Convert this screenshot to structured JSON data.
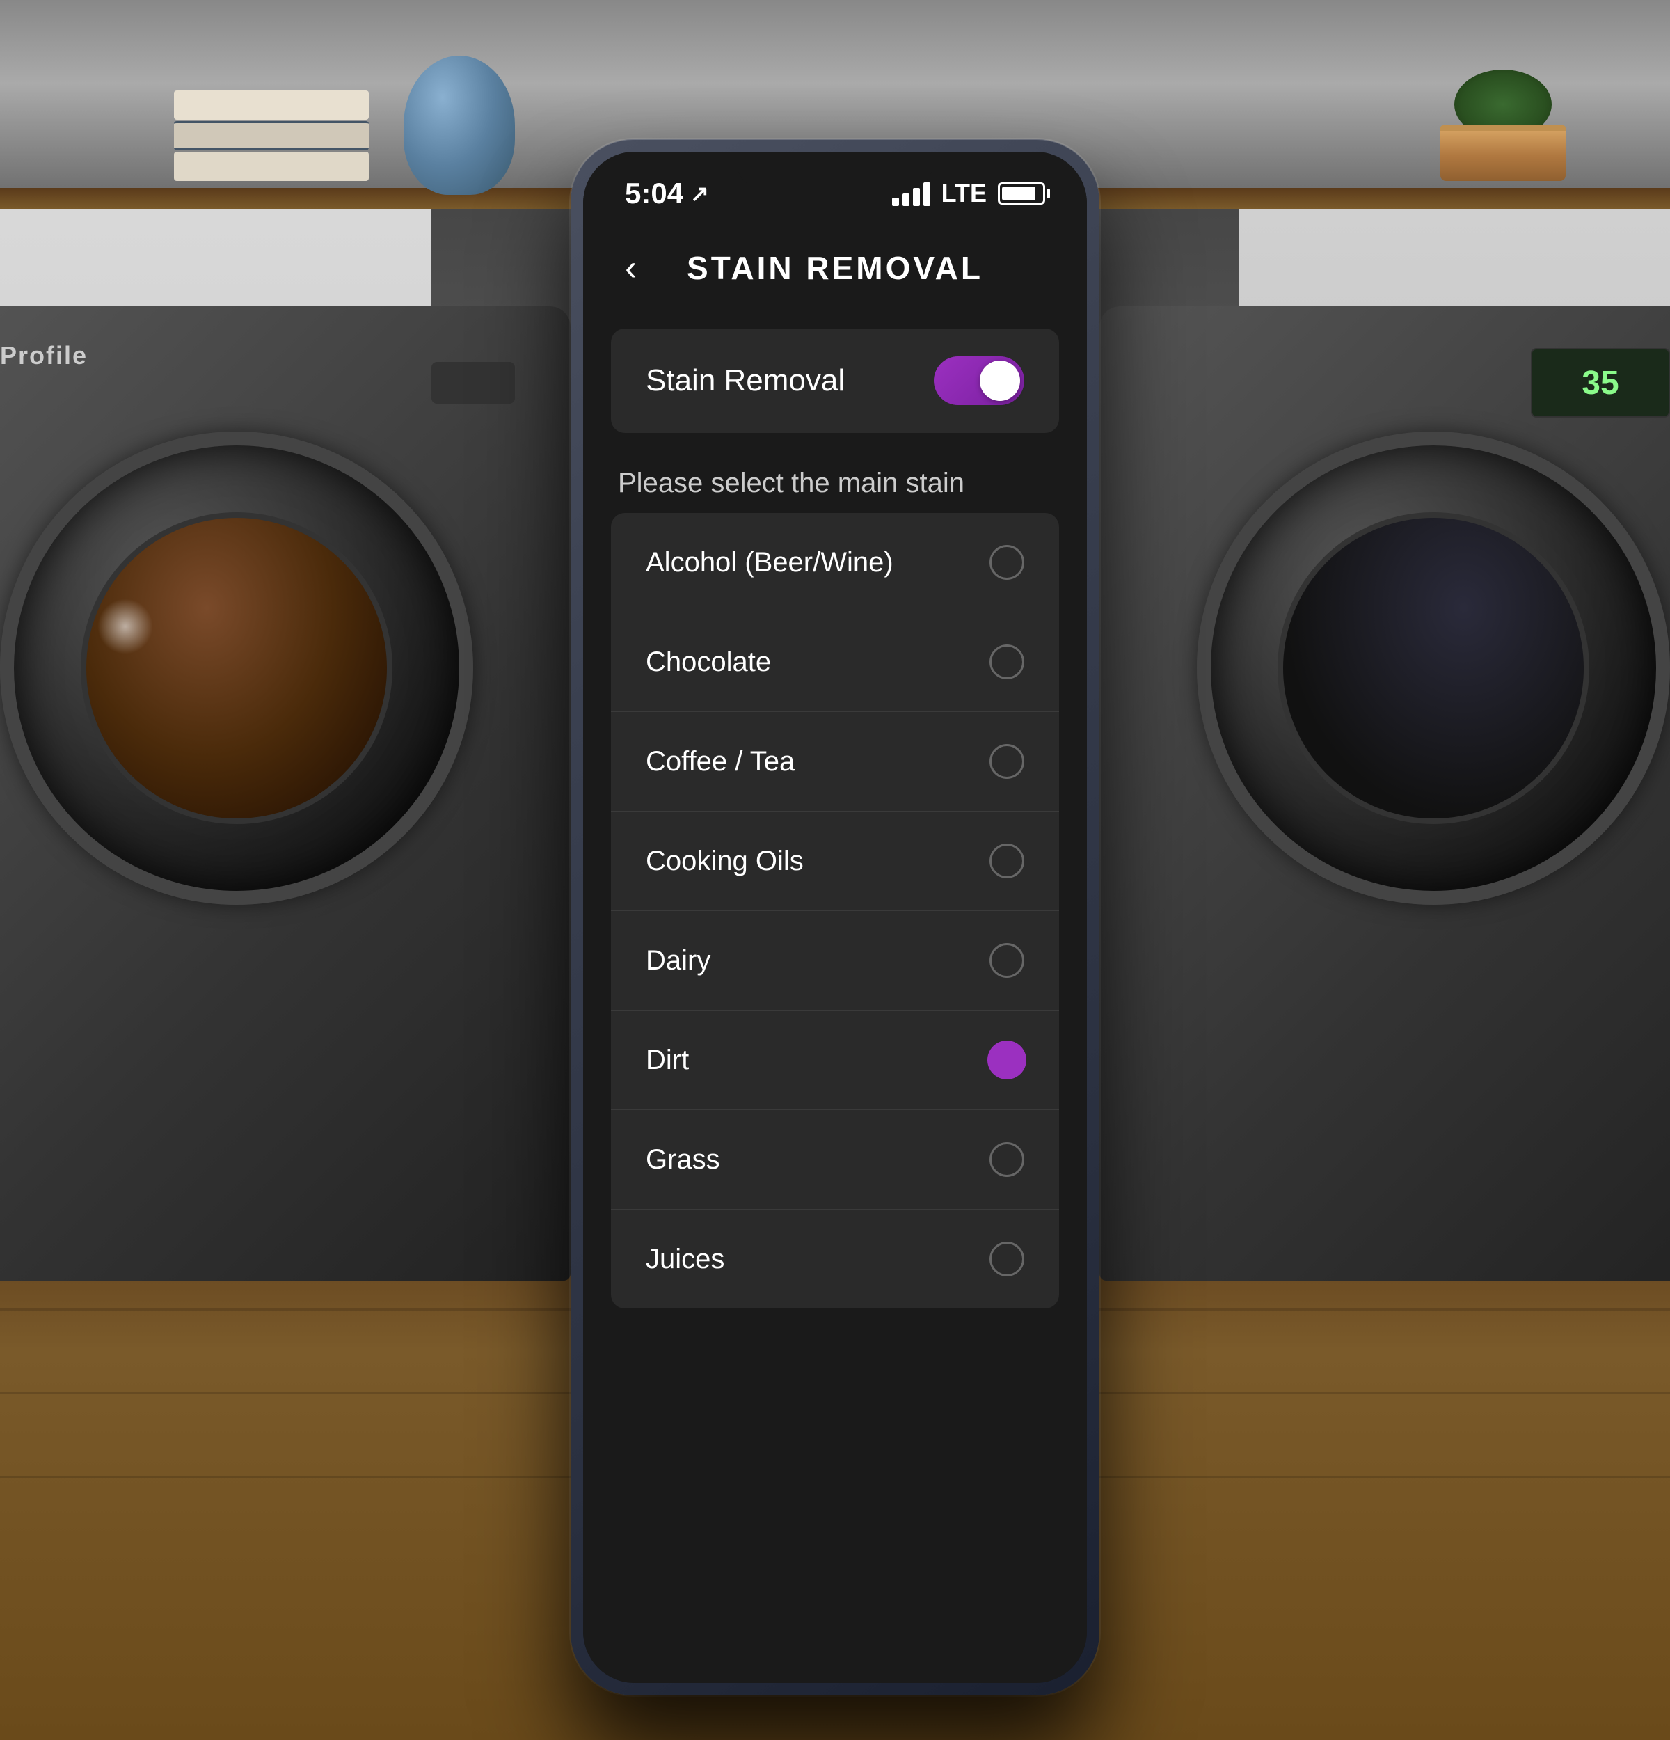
{
  "background": {
    "shelf_color": "#888888",
    "wall_left_color": "#d0d0d0",
    "wall_right_color": "#c8c8c8"
  },
  "phone": {
    "status_bar": {
      "time": "5:04",
      "signal_label": "LTE",
      "battery_percent": 85
    },
    "header": {
      "back_label": "<",
      "title": "STAIN REMOVAL"
    },
    "toggle_row": {
      "label": "Stain Removal",
      "enabled": true
    },
    "section_label": "Please select the main stain",
    "stain_items": [
      {
        "name": "Alcohol (Beer/Wine)",
        "selected": false
      },
      {
        "name": "Chocolate",
        "selected": false
      },
      {
        "name": "Coffee / Tea",
        "selected": false
      },
      {
        "name": "Cooking Oils",
        "selected": false
      },
      {
        "name": "Dairy",
        "selected": false
      },
      {
        "name": "Dirt",
        "selected": true
      },
      {
        "name": "Grass",
        "selected": false
      },
      {
        "name": "Juices",
        "selected": false
      }
    ],
    "accent_color": "#9b30c0"
  },
  "icons": {
    "back_arrow": "‹",
    "location_arrow": "↗"
  }
}
